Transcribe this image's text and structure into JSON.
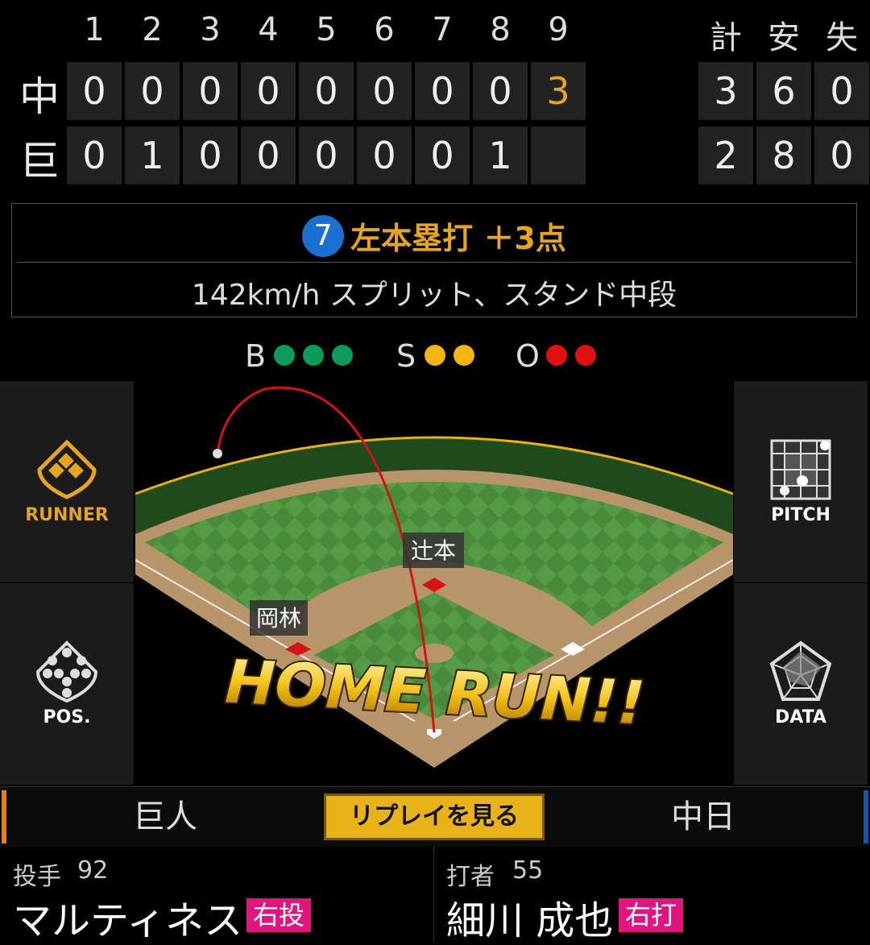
{
  "scoreboard": {
    "innings": [
      "1",
      "2",
      "3",
      "4",
      "5",
      "6",
      "7",
      "8",
      "9"
    ],
    "total_headers": [
      "計",
      "安",
      "失"
    ],
    "teams": [
      {
        "abbr": "中",
        "scores": [
          "0",
          "0",
          "0",
          "0",
          "0",
          "0",
          "0",
          "0",
          "3"
        ],
        "totals": [
          "3",
          "6",
          "0"
        ]
      },
      {
        "abbr": "巨",
        "scores": [
          "0",
          "1",
          "0",
          "0",
          "0",
          "0",
          "0",
          "1",
          ""
        ],
        "totals": [
          "2",
          "8",
          "0"
        ]
      }
    ],
    "highlight_color": "#e6a425"
  },
  "play": {
    "inning": "7",
    "title": "左本塁打 ＋3点",
    "detail": "142km/h スプリット、スタンド中段"
  },
  "count": {
    "balls_label": "B",
    "balls": 3,
    "ball_color": "#0e9a5a",
    "strikes_label": "S",
    "strikes": 2,
    "strike_color": "#f2b511",
    "outs_label": "O",
    "outs": 2,
    "out_color": "#e01010"
  },
  "side_buttons": {
    "runner": "RUNNER",
    "pitch": "PITCH",
    "pos": "POS.",
    "data": "DATA"
  },
  "field": {
    "runner_second": "辻本",
    "runner_first": "岡林",
    "banner": "HOME RUN!!"
  },
  "tabs": {
    "home": "巨人",
    "replay": "リプレイを見る",
    "away": "中日"
  },
  "pitcher": {
    "role": "投手",
    "number": "92",
    "name": "マルティネス",
    "hand": "右投"
  },
  "batter": {
    "role": "打者",
    "number": "55",
    "name": "細川 成也",
    "hand": "右打"
  }
}
